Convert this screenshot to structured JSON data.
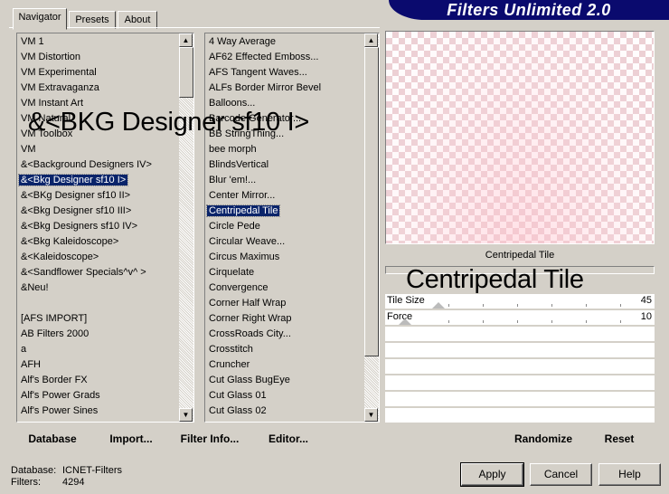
{
  "app": {
    "title": "Filters Unlimited 2.0"
  },
  "tabs": [
    {
      "label": "Navigator",
      "active": true
    },
    {
      "label": "Presets",
      "active": false
    },
    {
      "label": "About",
      "active": false
    }
  ],
  "categories": {
    "items": [
      "VM 1",
      "VM Distortion",
      "VM Experimental",
      "VM Extravaganza",
      "VM Instant Art",
      "VM Natural",
      "VM Toolbox",
      "VM",
      "&<Background Designers IV>",
      "&<Bkg Designer sf10 I>",
      "&<BKg Designer sf10 II>",
      "&<Bkg Designer sf10 III>",
      "&<Bkg Designers sf10 IV>",
      "&<Bkg Kaleidoscope>",
      "&<Kaleidoscope>",
      "&<Sandflower Specials^v^ >",
      "&Neu!",
      "",
      "[AFS IMPORT]",
      "AB Filters 2000",
      "a",
      "AFH",
      "Alf's Border FX",
      "Alf's Power Grads",
      "Alf's Power Sines"
    ],
    "selected_index": 9
  },
  "filters": {
    "items": [
      "4 Way Average",
      "AF62 Effected Emboss...",
      "AFS Tangent Waves...",
      "ALFs Border Mirror Bevel",
      "Balloons...",
      "Barcode Generator...",
      "BB StringThing...",
      "bee morph",
      "BlindsVertical",
      "Blur 'em!...",
      "Center Mirror...",
      "Centripedal Tile",
      "Circle Pede",
      "Circular Weave...",
      "Circus Maximus",
      "Cirquelate",
      "Convergence",
      "Corner Half Wrap",
      "Corner Right Wrap",
      "CrossRoads City...",
      "Crosstitch",
      "Cruncher",
      "Cut Glass  BugEye",
      "Cut Glass 01",
      "Cut Glass 02"
    ],
    "selected_index": 11
  },
  "overlays": {
    "category": "&<BKG Designer sf10 I>",
    "filter": "Centripedal Tile"
  },
  "preview": {
    "filter_name": "Centripedal Tile"
  },
  "parameters": [
    {
      "name": "Tile Size",
      "value": "45",
      "level": 0.176
    },
    {
      "name": "Force",
      "value": "10",
      "level": 0.039
    }
  ],
  "toolbar": {
    "database": "Database",
    "import": "Import...",
    "filter_info": "Filter Info...",
    "editor": "Editor...",
    "randomize": "Randomize",
    "reset": "Reset"
  },
  "status": {
    "database_label": "Database:",
    "database_value": "ICNET-Filters",
    "filters_label": "Filters:",
    "filters_value": "4294"
  },
  "buttons": {
    "apply": "Apply",
    "cancel": "Cancel",
    "help": "Help"
  }
}
